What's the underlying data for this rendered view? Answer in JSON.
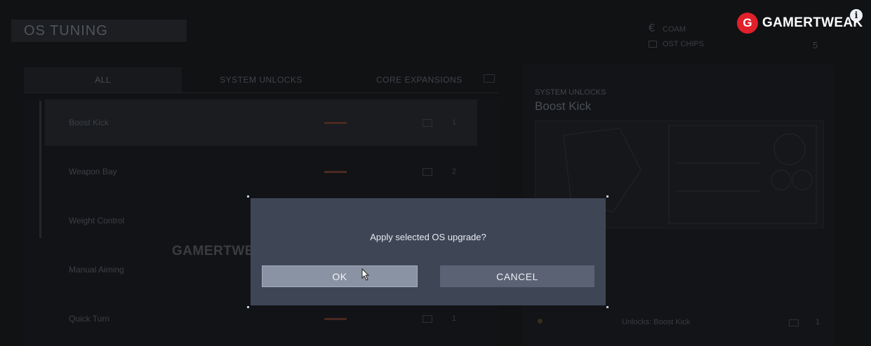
{
  "background": {
    "title": "OS TUNING",
    "tabs": [
      "ALL",
      "SYSTEM UNLOCKS",
      "CORE EXPANSIONS"
    ],
    "items": [
      {
        "label": "Boost Kick",
        "count": "1"
      },
      {
        "label": "Weapon Bay",
        "count": "2"
      },
      {
        "label": "Weight Control",
        "count": ""
      },
      {
        "label": "Manual Aiming",
        "count": ""
      },
      {
        "label": "Quick Turn",
        "count": "1"
      }
    ],
    "detail": {
      "category": "SYSTEM UNLOCKS",
      "name": "Boost Kick",
      "unlock_label": "Unlocks: Boost Kick",
      "count": "1"
    },
    "hud": {
      "coam_label": "COAM",
      "ost_label": "OST CHIPS",
      "ost_value": "5"
    },
    "watermark": "GAMERTWEAK"
  },
  "dialog": {
    "message": "Apply selected OS upgrade?",
    "ok_label": "OK",
    "cancel_label": "CANCEL"
  },
  "brand": {
    "logo_letter": "G",
    "name": "GAMERTWEAK",
    "info_glyph": "i"
  },
  "colors": {
    "dialog_bg": "#3e4656",
    "ok_bg": "#8a93a3",
    "cancel_bg": "#5a6274",
    "brand_red": "#e0202a"
  }
}
